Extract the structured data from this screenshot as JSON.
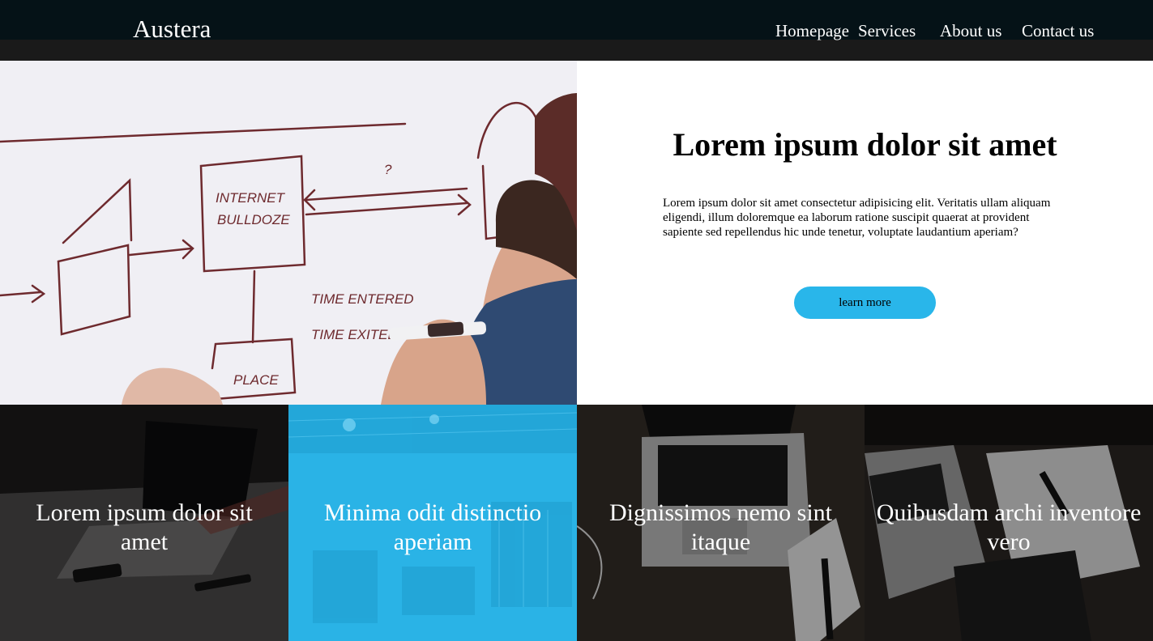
{
  "header": {
    "logo": "Austera",
    "nav": [
      "Homepage",
      "Services",
      "About us",
      "Contact us"
    ]
  },
  "hero": {
    "photo_icon": "whiteboard-person-photo",
    "whiteboard_words": [
      "INTERNET",
      "BULLDOZE",
      "?",
      "TIME ENTERED",
      "TIME EXITED",
      "PLACE"
    ],
    "title": "Lorem ipsum dolor sit amet",
    "body": "Lorem ipsum dolor sit amet consectetur adipisicing elit. Veritatis ullam aliquam eligendi, illum doloremque ea laborum ratione suscipit quaerat at provident sapiente sed repellendus hic unde tenetur, voluptate laudantium aperiam?",
    "button": "learn more",
    "accent_color": "#29b6ea"
  },
  "cards": [
    {
      "title": "Lorem ipsum dolor sit amet",
      "image": "laptop-desk-photo"
    },
    {
      "title": "Minima odit distinctio aperiam",
      "image": "office-hall-photo",
      "tint": "#29b6ea"
    },
    {
      "title": "Dignissimos nemo sint itaque",
      "image": "laptop-keyboard-photo"
    },
    {
      "title": "Quibusdam archi inventore vero",
      "image": "laptop-notebook-photo"
    }
  ]
}
